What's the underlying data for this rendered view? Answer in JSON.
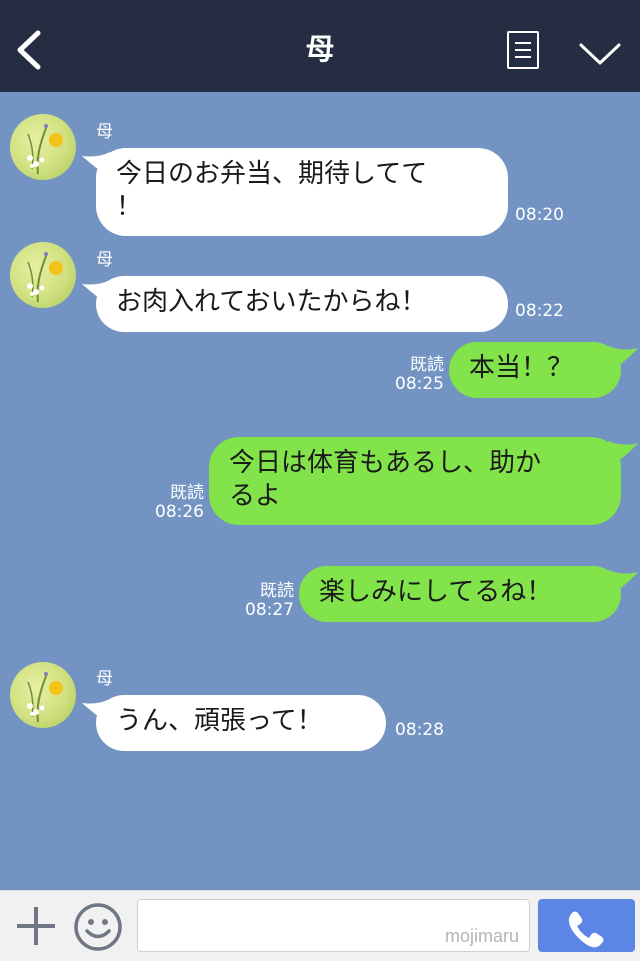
{
  "header": {
    "title": "母",
    "back_icon": "chevron-left-icon",
    "menu_icon": "list-menu-icon",
    "collapse_icon": "chevron-down-icon"
  },
  "messages": [
    {
      "direction": "in",
      "sender": "母",
      "lines": [
        "今日のお弁当、期待してて",
        "！"
      ],
      "time": "08:20"
    },
    {
      "direction": "in",
      "sender": "母",
      "lines": [
        "お肉入れておいたからね！"
      ],
      "time": "08:22"
    },
    {
      "direction": "out",
      "read": "既読",
      "lines": [
        "本当！？"
      ],
      "time": "08:25"
    },
    {
      "direction": "out",
      "read": "既読",
      "lines": [
        "今日は体育もあるし、助か",
        "るよ"
      ],
      "time": "08:26"
    },
    {
      "direction": "out",
      "read": "既読",
      "lines": [
        "楽しみにしてるね！"
      ],
      "time": "08:27"
    },
    {
      "direction": "in",
      "sender": "母",
      "lines": [
        "うん、頑張って！"
      ],
      "time": "08:28"
    }
  ],
  "input": {
    "placeholder": "",
    "watermark": "mojimaru",
    "plus_icon": "plus-icon",
    "emoji_icon": "smiley-icon",
    "call_icon": "phone-icon"
  },
  "colors": {
    "header_bg": "#252d42",
    "chat_bg": "#7394c2",
    "incoming_bubble": "#ffffff",
    "outgoing_bubble": "#83e34a",
    "call_button": "#5b86e6"
  }
}
